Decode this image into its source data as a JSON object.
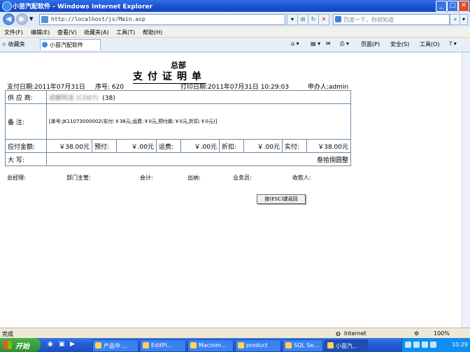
{
  "window": {
    "title": "小苗汽配软件 - Windows Internet Explorer",
    "min": "_",
    "max": "□",
    "close": "✕"
  },
  "address": {
    "url": "http://localhost/js/Main.asp",
    "search_placeholder": "百度一下，你就知道"
  },
  "menu": [
    "文件(F)",
    "编辑(E)",
    "查看(V)",
    "收藏夹(A)",
    "工具(T)",
    "帮助(H)"
  ],
  "tabbar": {
    "favorites": "收藏夹",
    "tab_title": "小苗汽配软件",
    "commands": [
      "页面(P)",
      "安全(S)",
      "工具(O)"
    ]
  },
  "doc": {
    "subtitle": "总部",
    "title": "支付证明单",
    "pay_date": "支付日期:2011年07月31日",
    "serial": "序号: 620",
    "print_date": "打印日期:2011年07月31日  10:29:03",
    "applicant": "申办人:admin",
    "supplier_label": "供 应 商:",
    "supplier_value": "成都阿龙 (CD07)",
    "supplier_count": "(38)",
    "remark_label": "备    注:",
    "remark_value": "[单号:JK11073000002(实付:￥38元;运费:￥0元,预付款:￥0元,折扣:￥0元)]",
    "amount_label": "应付金额:",
    "amount_value": "￥38.00元",
    "prepay_label": "预付:",
    "prepay_value": "￥.00元",
    "freight_label": "运费:",
    "freight_value": "￥.00元",
    "discount_label": "折扣:",
    "discount_value": "￥.00元",
    "paid_label": "实付:",
    "paid_value": "￥38.00元",
    "capital_label": "大    写:",
    "capital_value": "叁拾捌圆整",
    "signers": [
      "总经理:",
      "部门主管:",
      "会计:",
      "出纳:",
      "业务员:",
      "收款人:"
    ],
    "esc_button": "按(ESC)键返回"
  },
  "status": {
    "left": "完成",
    "zone": "Internet",
    "zoom": "100%"
  },
  "taskbar": {
    "start": "开始",
    "tasks": [
      "产品中 ...",
      "EditPl...",
      "Macrom...",
      "product",
      "SQL Se...",
      "小苗汽..."
    ],
    "clock": "10:29"
  }
}
